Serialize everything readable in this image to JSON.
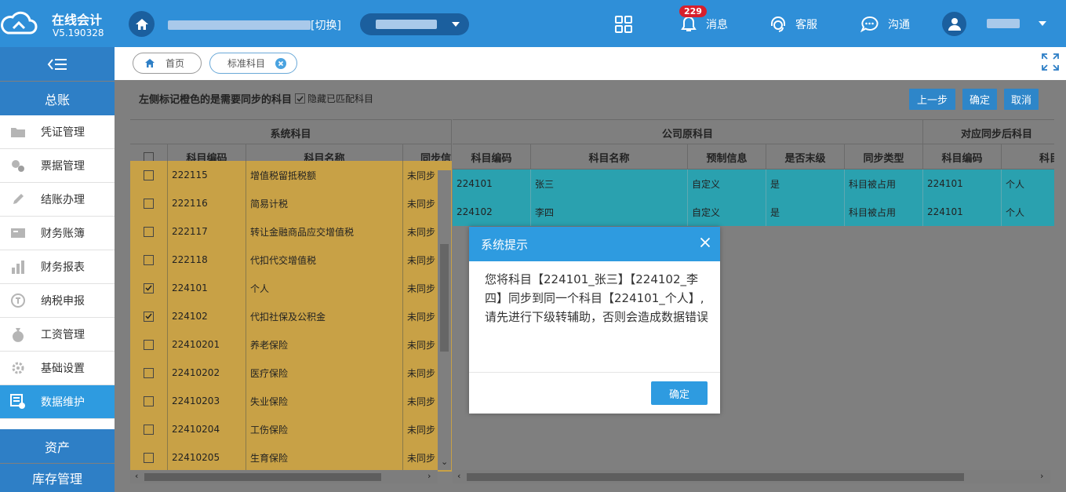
{
  "app": {
    "title": "在线会计",
    "version": "V5.190328",
    "switch_label": "[切换]"
  },
  "topbar": {
    "notice_count": "229",
    "notice_label": "消息",
    "service_label": "客服",
    "chat_label": "沟通"
  },
  "sidebar": {
    "section_gl": "总账",
    "items": [
      "凭证管理",
      "票据管理",
      "结账办理",
      "财务账簿",
      "财务报表",
      "纳税申报",
      "工资管理",
      "基础设置",
      "数据维护"
    ],
    "section_assets": "资产",
    "section_inventory": "库存管理"
  },
  "tabs": {
    "home": "首页",
    "current": "标准科目"
  },
  "toolbar": {
    "hint": "左侧标记橙色的是需要同步的科目",
    "hide_matched_label": "隐藏已匹配科目",
    "prev_label": "上一步",
    "ok_label": "确定",
    "cancel_label": "取消"
  },
  "left_table": {
    "group_header": "系统科目",
    "headers": [
      "科目编码",
      "科目名称",
      "同步信息"
    ],
    "rows": [
      {
        "code": "222115",
        "name": "增值税留抵税额",
        "sync": "未同步",
        "checked": false
      },
      {
        "code": "222116",
        "name": "简易计税",
        "sync": "未同步",
        "checked": false
      },
      {
        "code": "222117",
        "name": "转让金融商品应交增值税",
        "sync": "未同步",
        "checked": false
      },
      {
        "code": "222118",
        "name": "代扣代交增值税",
        "sync": "未同步",
        "checked": false
      },
      {
        "code": "224101",
        "name": "个人",
        "sync": "未同步",
        "checked": true
      },
      {
        "code": "224102",
        "name": "代扣社保及公积金",
        "sync": "未同步",
        "checked": true
      },
      {
        "code": "22410201",
        "name": "养老保险",
        "sync": "未同步",
        "checked": false
      },
      {
        "code": "22410202",
        "name": "医疗保险",
        "sync": "未同步",
        "checked": false
      },
      {
        "code": "22410203",
        "name": "失业保险",
        "sync": "未同步",
        "checked": false
      },
      {
        "code": "22410204",
        "name": "工伤保险",
        "sync": "未同步",
        "checked": false
      },
      {
        "code": "22410205",
        "name": "生育保险",
        "sync": "未同步",
        "checked": false
      }
    ]
  },
  "right_table": {
    "group_original": "公司原科目",
    "group_synced": "对应同步后科目",
    "headers": [
      "科目编码",
      "科目名称",
      "预制信息",
      "是否末级",
      "同步类型",
      "科目编码",
      "科目名称"
    ],
    "rows": [
      {
        "code": "224101",
        "name": "张三",
        "preset": "自定义",
        "leaf": "是",
        "sync_type": "科目被占用",
        "target_code": "224101",
        "target_name": "个人"
      },
      {
        "code": "224102",
        "name": "李四",
        "preset": "自定义",
        "leaf": "是",
        "sync_type": "科目被占用",
        "target_code": "224101",
        "target_name": "个人"
      }
    ]
  },
  "dialog": {
    "title": "系统提示",
    "message": "您将科目【224101_张三】【224102_李四】同步到同一个科目【224101_个人】,请先进行下级转辅助，否则会造成数据错误",
    "ok_label": "确定"
  },
  "colors": {
    "topbar": "#2f8fd8",
    "accent": "#2e9be0",
    "sync_needed_row": "#c8a146",
    "matched_row": "#2aa1af"
  }
}
